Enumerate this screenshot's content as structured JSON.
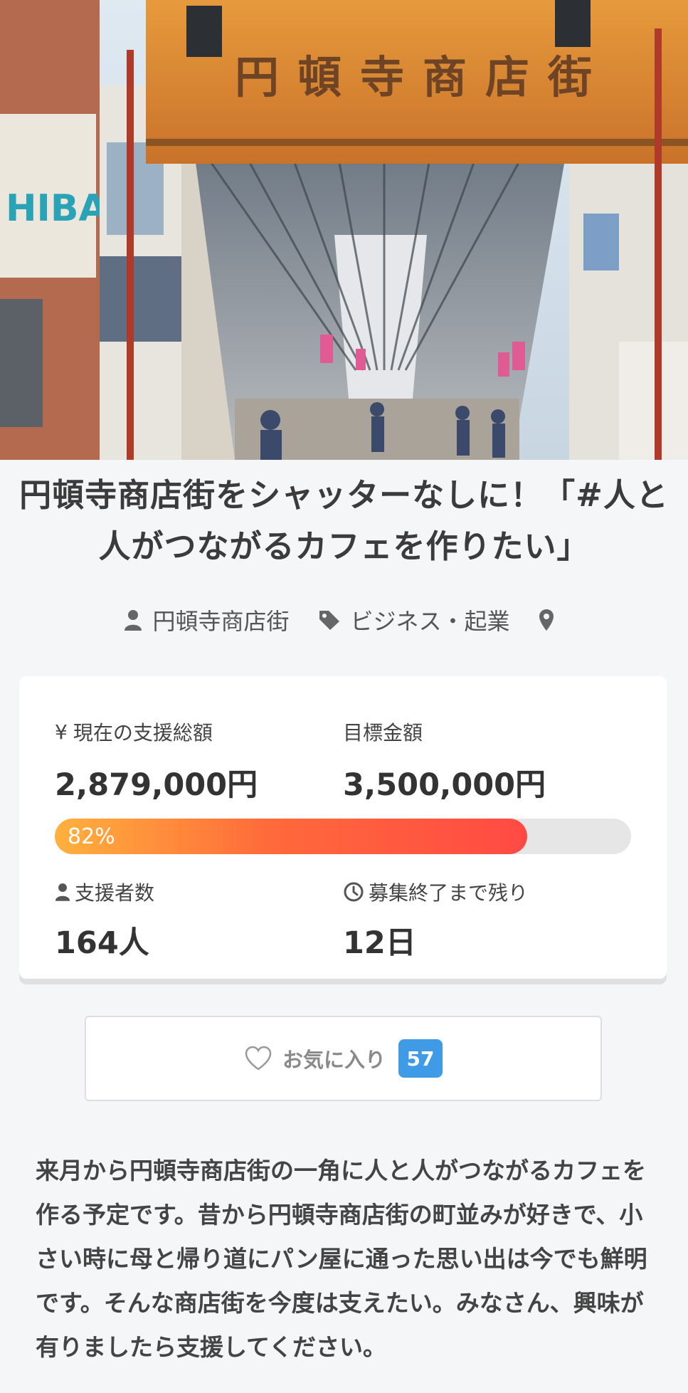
{
  "project": {
    "title": "円頓寺商店街をシャッターなしに！「#人と人がつながるカフェを作りたい」",
    "owner": "円頓寺商店街",
    "category": "ビジネス・起業",
    "location": "",
    "hero_sign_text": "円頓寺商店街"
  },
  "stats": {
    "current_label": "現在の支援総額",
    "current_value": "2,879,000円",
    "goal_label": "目標金額",
    "goal_value": "3,500,000円",
    "progress_percent": 82,
    "progress_text": "82%",
    "supporters_label": "支援者数",
    "supporters_value": "164人",
    "remaining_label": "募集終了まで残り",
    "remaining_value": "12日"
  },
  "favorite": {
    "label": "お気に入り",
    "count": "57"
  },
  "description": "来月から円頓寺商店街の一角に人と人がつながるカフェを作る予定です。昔から円頓寺商店街の町並みが好きで、小さい時に母と帰り道にパン屋に通った思い出は今でも鮮明です。そんな商店街を今度は支えたい。みなさん、興味が有りましたら支援してください。",
  "colors": {
    "accent": "#3f9be6",
    "progress_start": "#ffb13d",
    "progress_end": "#ff4a44"
  },
  "icons": [
    "user-icon",
    "tag-icon",
    "map-pin-icon",
    "yen-icon",
    "clock-icon",
    "heart-icon"
  ]
}
